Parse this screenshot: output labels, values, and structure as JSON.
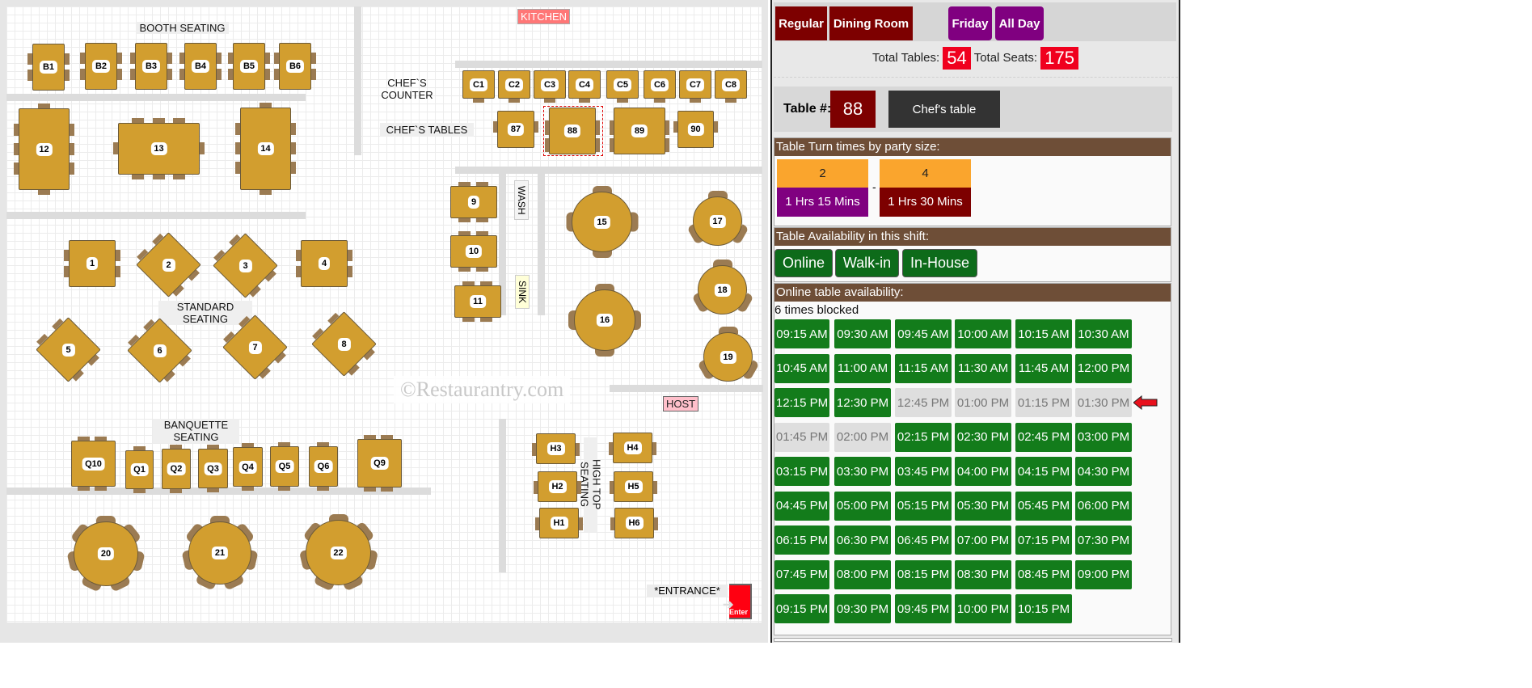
{
  "floor": {
    "labels": {
      "booth": "BOOTH SEATING",
      "chefs_counter": "CHEF`S COUNTER",
      "chefs_tables": "CHEF`S TABLES",
      "standard": "STANDARD SEATING",
      "banquette": "BANQUETTE SEATING",
      "high_top": "HIGH TOP SEATING",
      "kitchen": "KITCHEN",
      "host": "HOST",
      "wash": "WASH",
      "sink": "SINK",
      "entrance": "*ENTRANCE*",
      "enter": "Enter",
      "watermark": "©Restaurantry.com"
    },
    "booths": [
      "B1",
      "B2",
      "B3",
      "B4",
      "B5",
      "B6"
    ],
    "counter": [
      "C1",
      "C2",
      "C3",
      "C4",
      "C5",
      "C6",
      "C7",
      "C8"
    ],
    "chefs_tables": [
      "87",
      "88",
      "89",
      "90"
    ],
    "selected_table": "88",
    "large_rect": [
      "12",
      "13",
      "14"
    ],
    "standard": [
      "1",
      "2",
      "3",
      "4",
      "5",
      "6",
      "7",
      "8"
    ],
    "side_rect": [
      "9",
      "10",
      "11"
    ],
    "rounds": [
      "15",
      "16",
      "17",
      "18",
      "19"
    ],
    "banquette": [
      "Q10",
      "Q1",
      "Q2",
      "Q3",
      "Q4",
      "Q5",
      "Q6",
      "Q9"
    ],
    "high_top": [
      "H3",
      "H4",
      "H2",
      "H5",
      "H1",
      "H6"
    ],
    "big_rounds": [
      "20",
      "21",
      "22"
    ]
  },
  "panel": {
    "filters": {
      "shift": "Regular",
      "area": "Dining Room",
      "day": "Friday",
      "period": "All Day"
    },
    "colors": {
      "maroon": "#7d0000",
      "purple": "#800080",
      "open": "#137c1b",
      "blocked": "#dedede",
      "header": "#6e4e37",
      "total_badge": "#f0001e"
    },
    "totals": {
      "tables_label": "Total Tables:",
      "tables": "54",
      "seats_label": "Total Seats:",
      "seats": "175"
    },
    "table": {
      "label": "Table #:",
      "number": "88",
      "name": "Chef's table"
    },
    "turn_times": {
      "title": "Table Turn times by party size:",
      "separator": "-",
      "items": [
        {
          "party": "2",
          "duration": "1 Hrs 15 Mins"
        },
        {
          "party": "4",
          "duration": "1 Hrs 30 Mins"
        }
      ]
    },
    "availability": {
      "title": "Table Availability in this shift:",
      "options": [
        "Online",
        "Walk-in",
        "In-House"
      ]
    },
    "online": {
      "title": "Online table availability:",
      "blocked_text": "6 times blocked",
      "slots": [
        {
          "t": "09:15 AM",
          "s": "open"
        },
        {
          "t": "09:30 AM",
          "s": "open"
        },
        {
          "t": "09:45 AM",
          "s": "open"
        },
        {
          "t": "10:00 AM",
          "s": "open"
        },
        {
          "t": "10:15 AM",
          "s": "open"
        },
        {
          "t": "10:30 AM",
          "s": "open"
        },
        {
          "t": "10:45 AM",
          "s": "open"
        },
        {
          "t": "11:00 AM",
          "s": "open"
        },
        {
          "t": "11:15 AM",
          "s": "open"
        },
        {
          "t": "11:30 AM",
          "s": "open"
        },
        {
          "t": "11:45 AM",
          "s": "open"
        },
        {
          "t": "12:00 PM",
          "s": "open"
        },
        {
          "t": "12:15 PM",
          "s": "open"
        },
        {
          "t": "12:30 PM",
          "s": "open"
        },
        {
          "t": "12:45 PM",
          "s": "blocked"
        },
        {
          "t": "01:00 PM",
          "s": "blocked"
        },
        {
          "t": "01:15 PM",
          "s": "blocked"
        },
        {
          "t": "01:30 PM",
          "s": "blocked"
        },
        {
          "t": "01:45 PM",
          "s": "blocked"
        },
        {
          "t": "02:00 PM",
          "s": "blocked"
        },
        {
          "t": "02:15 PM",
          "s": "open"
        },
        {
          "t": "02:30 PM",
          "s": "open"
        },
        {
          "t": "02:45 PM",
          "s": "open"
        },
        {
          "t": "03:00 PM",
          "s": "open"
        },
        {
          "t": "03:15 PM",
          "s": "open"
        },
        {
          "t": "03:30 PM",
          "s": "open"
        },
        {
          "t": "03:45 PM",
          "s": "open"
        },
        {
          "t": "04:00 PM",
          "s": "open"
        },
        {
          "t": "04:15 PM",
          "s": "open"
        },
        {
          "t": "04:30 PM",
          "s": "open"
        },
        {
          "t": "04:45 PM",
          "s": "open"
        },
        {
          "t": "05:00 PM",
          "s": "open"
        },
        {
          "t": "05:15 PM",
          "s": "open"
        },
        {
          "t": "05:30 PM",
          "s": "open"
        },
        {
          "t": "05:45 PM",
          "s": "open"
        },
        {
          "t": "06:00 PM",
          "s": "open"
        },
        {
          "t": "06:15 PM",
          "s": "open"
        },
        {
          "t": "06:30 PM",
          "s": "open"
        },
        {
          "t": "06:45 PM",
          "s": "open"
        },
        {
          "t": "07:00 PM",
          "s": "open"
        },
        {
          "t": "07:15 PM",
          "s": "open"
        },
        {
          "t": "07:30 PM",
          "s": "open"
        },
        {
          "t": "07:45 PM",
          "s": "open"
        },
        {
          "t": "08:00 PM",
          "s": "open"
        },
        {
          "t": "08:15 PM",
          "s": "open"
        },
        {
          "t": "08:30 PM",
          "s": "open"
        },
        {
          "t": "08:45 PM",
          "s": "open"
        },
        {
          "t": "09:00 PM",
          "s": "open"
        },
        {
          "t": "09:15 PM",
          "s": "open"
        },
        {
          "t": "09:30 PM",
          "s": "open"
        },
        {
          "t": "09:45 PM",
          "s": "open"
        },
        {
          "t": "10:00 PM",
          "s": "open"
        },
        {
          "t": "10:15 PM",
          "s": "open"
        }
      ],
      "pointer_at": "01:30 PM"
    }
  }
}
